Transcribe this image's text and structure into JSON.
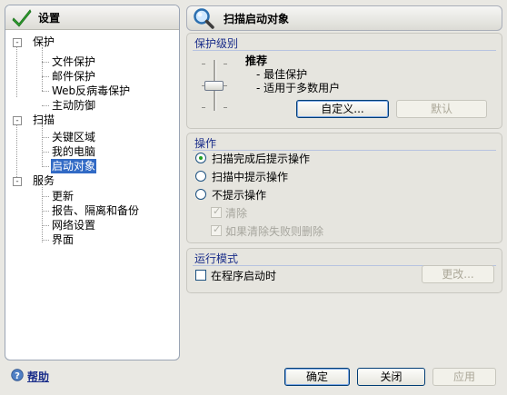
{
  "nav": {
    "title": "设置",
    "groups": [
      {
        "label": "保护",
        "toggle": "-",
        "items": [
          "文件保护",
          "邮件保护",
          "Web反病毒保护",
          "主动防御"
        ]
      },
      {
        "label": "扫描",
        "toggle": "-",
        "items": [
          "关键区域",
          "我的电脑",
          "启动对象"
        ]
      },
      {
        "label": "服务",
        "toggle": "-",
        "items": [
          "更新",
          "报告、隔离和备份",
          "网络设置",
          "界面"
        ]
      }
    ],
    "selected": "启动对象"
  },
  "page": {
    "title": "扫描启动对象"
  },
  "protection_level": {
    "title": "保护级别",
    "level_name": "推荐",
    "bullets": [
      "- 最佳保护",
      "- 适用于多数用户"
    ],
    "customize_label": "自定义...",
    "default_label": "默认"
  },
  "actions": {
    "title": "操作",
    "options": [
      {
        "label": "扫描完成后提示操作",
        "selected": true
      },
      {
        "label": "扫描中提示操作",
        "selected": false
      },
      {
        "label": "不提示操作",
        "selected": false
      }
    ],
    "sub_options": [
      {
        "label": "清除",
        "checked": true,
        "enabled": false
      },
      {
        "label": "如果清除失败则删除",
        "checked": true,
        "enabled": false
      }
    ]
  },
  "run_mode": {
    "title": "运行模式",
    "checkbox_label": "在程序启动时",
    "change_label": "更改..."
  },
  "footer": {
    "help_label": "帮助",
    "ok_label": "确定",
    "close_label": "关闭",
    "apply_label": "应用"
  },
  "colors": {
    "selection": "#316ac5",
    "group_title": "#1a2d8a",
    "help_link": "#1a2d8a"
  }
}
